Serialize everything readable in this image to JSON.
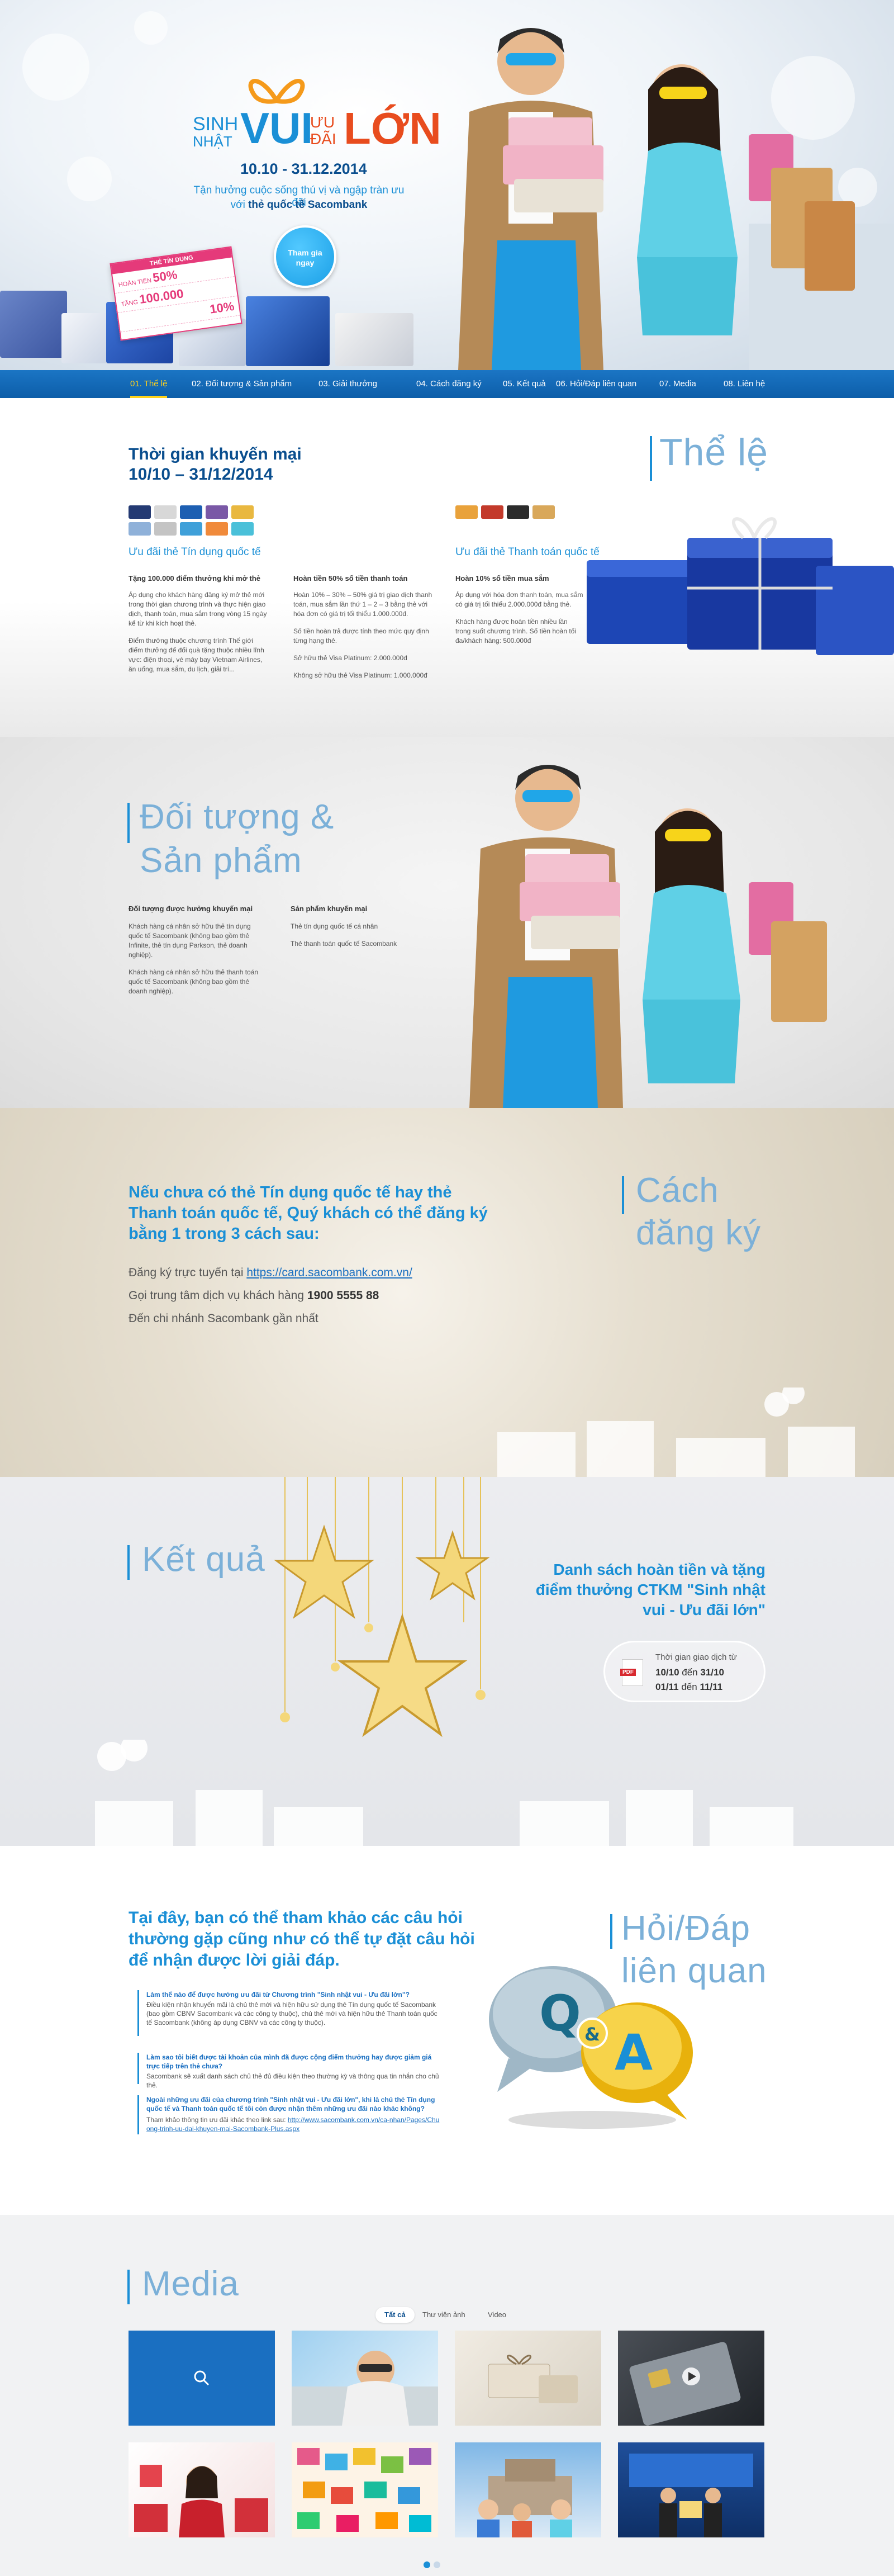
{
  "hero": {
    "logo": {
      "sinh": "SINH",
      "nhat": "NHẬT",
      "vui": "VUI",
      "uu": "ƯU",
      "dai": "ĐÃI",
      "lon": "LỚN"
    },
    "dates": "10.10 - 31.12.2014",
    "subtitle_line1": "Tận hưởng cuộc sống thú vị và ngập tràn ưu đãi",
    "subtitle_line2_prefix": "với ",
    "subtitle_line2_brand": "thẻ quốc tế Sacombank",
    "join_button": "Tham gia\nngay",
    "promo_tag": {
      "title": "THẺ TÍN DỤNG",
      "row1_label": "HOÀN TIỀN",
      "row1_value": "50%",
      "row2_label": "TẶNG",
      "row2_value": "100.000",
      "row3_value": "10%"
    }
  },
  "nav": {
    "items": [
      {
        "label": "01. Thể lệ",
        "active": true
      },
      {
        "label": "02. Đối tượng & Sản phẩm",
        "active": false
      },
      {
        "label": "03. Giải thưởng",
        "active": false
      },
      {
        "label": "04. Cách đăng ký",
        "active": false
      },
      {
        "label": "05. Kết quả",
        "active": false
      },
      {
        "label": "06. Hỏi/Đáp liên quan",
        "active": false
      },
      {
        "label": "07. Media",
        "active": false
      },
      {
        "label": "08. Liên hệ",
        "active": false
      }
    ]
  },
  "the_le": {
    "section_title": "Thể lệ",
    "heading_line1": "Thời gian khuyến mại",
    "heading_line2": "10/10 – 31/12/2014",
    "credit_label": "Ưu đãi thẻ Tín dụng quốc tế",
    "debit_label": "Ưu đãi thẻ Thanh toán quốc tế",
    "col1": {
      "title": "Tặng 100.000 điểm thưởng khi mở thẻ",
      "p1": "Áp dụng cho khách hàng đăng ký mở thẻ mới trong thời gian chương trình và thực hiện giao dịch, thanh toán, mua sắm trong vòng 15 ngày kể từ khi kích hoạt thẻ.",
      "p2": "Điểm thưởng thuộc chương trình Thế giới điểm thưởng để đổi quà tặng thuộc nhiều lĩnh vực: điện thoại, vé máy bay Vietnam Airlines, ăn uống, mua sắm, du lịch, giải trí..."
    },
    "col2": {
      "title": "Hoàn tiền 50% số tiền thanh toán",
      "p1": "Hoàn 10% – 30% – 50% giá trị giao dịch thanh toán, mua sắm lần thứ 1 – 2 – 3 bằng thẻ với hóa đơn có giá trị tối thiểu 1.000.000đ.",
      "p2": "Số tiền hoàn trả được tính theo mức quy định từng hạng thẻ.",
      "p3": "Sở hữu thẻ Visa Platinum: 2.000.000đ",
      "p4": "Không sở hữu thẻ Visa Platinum: 1.000.000đ"
    },
    "col3": {
      "title": "Hoàn 10% số tiền mua sắm",
      "p1": "Áp dụng với hóa đơn thanh toán, mua sắm có giá trị tối thiểu 2.000.000đ bằng thẻ.",
      "p2": "Khách hàng được hoàn tiền nhiều lần trong suốt chương trình. Số tiền hoàn tối đa/khách hàng: 500.000đ"
    }
  },
  "doi_tuong": {
    "section_title_line1": "Đối tượng &",
    "section_title_line2": "Sản phẩm",
    "col1_title": "Đối tượng được hưởng khuyến mại",
    "col1_p1": "Khách hàng cá nhân sở hữu thẻ tín dụng quốc tế Sacombank (không bao gồm thẻ Infinite, thẻ tín dụng Parkson, thẻ doanh nghiệp).",
    "col1_p2": "Khách hàng cá nhân sở hữu thẻ thanh toán quốc tế Sacombank (không bao gồm thẻ doanh nghiệp).",
    "col2_title": "Sản phẩm khuyến mại",
    "col2_p1": "Thẻ tín dụng quốc tế cá nhân",
    "col2_p2": "Thẻ thanh toán quốc tế Sacombank"
  },
  "cach_dang_ky": {
    "section_title_line1": "Cách",
    "section_title_line2": "đăng ký",
    "heading_line1": "Nếu chưa có thẻ Tín dụng quốc tế hay thẻ",
    "heading_line2": "Thanh toán quốc tế, Quý khách có thể đăng ký",
    "heading_line3": "bằng 1 trong 3 cách sau:",
    "way1_prefix": "Đăng ký trực tuyến tại ",
    "way1_link": "https://card.sacombank.com.vn/",
    "way2_prefix": "Gọi trung tâm dịch vụ khách hàng ",
    "way2_phone": "1900 5555 88",
    "way3": "Đến chi nhánh Sacombank gần nhất"
  },
  "ket_qua": {
    "section_title": "Kết quả",
    "heading_line1": "Danh sách hoàn tiền và tặng",
    "heading_line2": "điểm thưởng CTKM \"Sinh nhật",
    "heading_line3": "vui - Ưu đãi lớn\"",
    "pdf_label": "PDF",
    "period_label": "Thời gian giao dịch từ",
    "period1_from": "10/10",
    "period1_to": "31/10",
    "period2_from": "01/11",
    "period2_to": "11/11",
    "connector": "đến"
  },
  "hoi_dap": {
    "section_title_line1": "Hỏi/Đáp",
    "section_title_line2": "liên quan",
    "heading_line1": "Tại đây, bạn có thể tham khảo các câu hỏi",
    "heading_line2": "thường gặp cũng như có thể tự đặt câu hỏi",
    "heading_line3": "để nhận được lời giải đáp.",
    "q1": "Làm thế nào để được hưởng ưu đãi từ Chương trình \"Sinh nhật vui - Ưu đãi lớn\"?",
    "a1": "Điều kiện nhận khuyến mãi là chủ thẻ mới và hiện hữu sử dụng thẻ Tín dụng quốc tế Sacombank (bao gồm CBNV Sacombank và các công ty thuộc), chủ thẻ mới và hiện hữu thẻ Thanh toán quốc tế Sacombank (không áp dụng CBNV và các công ty thuộc).",
    "q2": "Làm sao tôi biết được tài khoản của mình đã được cộng điểm thưởng hay được giảm giá trực tiếp trên thẻ chưa?",
    "a2": "Sacombank sẽ xuất danh sách chủ thẻ đủ điều kiện theo thường kỳ và thông qua tin nhắn cho chủ thẻ.",
    "q3": "Ngoài những ưu đãi của chương trình \"Sinh nhật vui - Ưu đãi lớn\", khi là chủ thẻ Tín dụng quốc tế và Thanh toán quốc tế tôi còn được nhận thêm những ưu đãi nào khác không?",
    "a3_prefix": "Tham khảo thông tin ưu đãi khác theo link sau: ",
    "a3_link": "http://www.sacombank.com.vn/ca-nhan/Pages/Chuong-trinh-uu-dai-khuyen-mai-Sacombank-Plus.aspx"
  },
  "media": {
    "section_title": "Media",
    "tabs": [
      "Tất cả",
      "Thư viện ảnh",
      "Video"
    ],
    "tab_active_index": 0,
    "pagination_pages": 2,
    "pagination_active": 1
  },
  "colors": {
    "brand_blue": "#1a8fd6",
    "dark_blue": "#0a4e8e",
    "accent_orange": "#e84c1e",
    "nav_active": "#ffd21a",
    "pink": "#e53a7a"
  }
}
